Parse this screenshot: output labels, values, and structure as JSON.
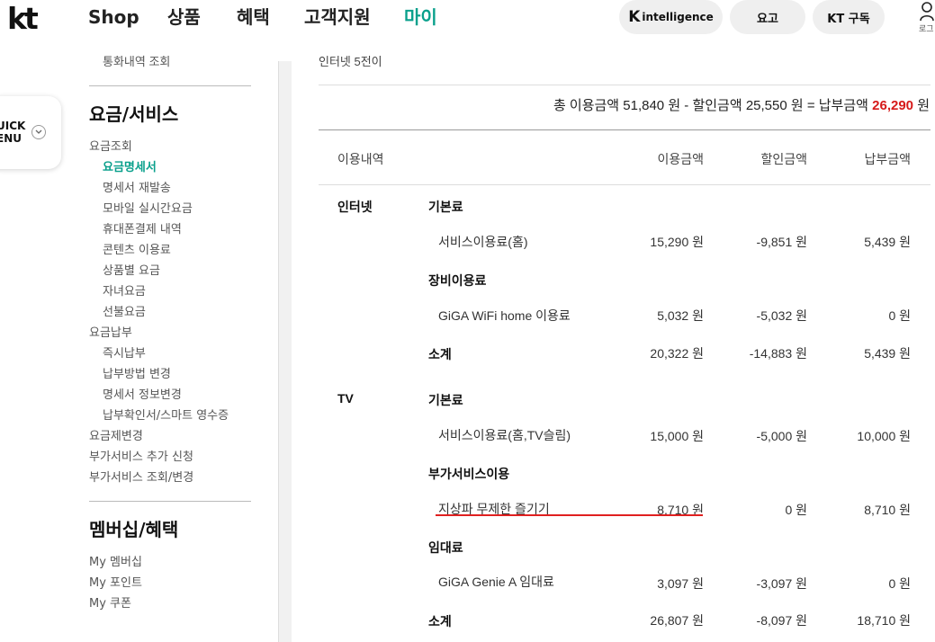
{
  "header": {
    "logo": "kt",
    "nav": [
      "Shop",
      "상품",
      "혜택",
      "고객지원",
      "마이"
    ],
    "active_nav": "마이",
    "pills": {
      "intelligence_k": "K",
      "intelligence_text": "intelligence",
      "fee": "요고",
      "subscribe": "KT 구독"
    },
    "login_label": "로그"
  },
  "quick_menu": {
    "line1": "UICK",
    "line2": "ENU"
  },
  "sidebar": {
    "top_cut_item": "통화내역 조회",
    "section1_title": "요금/서비스",
    "items": [
      {
        "label": "요금조회",
        "level": 1
      },
      {
        "label": "요금명세서",
        "level": 2,
        "active": true
      },
      {
        "label": "명세서 재발송",
        "level": 2
      },
      {
        "label": "모바일 실시간요금",
        "level": 2
      },
      {
        "label": "휴대폰결제 내역",
        "level": 2
      },
      {
        "label": "콘텐츠 이용료",
        "level": 2
      },
      {
        "label": "상품별 요금",
        "level": 2
      },
      {
        "label": "자녀요금",
        "level": 2
      },
      {
        "label": "선불요금",
        "level": 2
      },
      {
        "label": "요금납부",
        "level": 1
      },
      {
        "label": "즉시납부",
        "level": 2
      },
      {
        "label": "납부방법 변경",
        "level": 2
      },
      {
        "label": "명세서 정보변경",
        "level": 2
      },
      {
        "label": "납부확인서/스마트 영수증",
        "level": 2
      },
      {
        "label": "요금제변경",
        "level": 1
      },
      {
        "label": "부가서비스 추가 신청",
        "level": 1
      },
      {
        "label": "부가서비스 조회/변경",
        "level": 1
      }
    ],
    "section2_title": "멤버십/혜택",
    "section2_items": [
      "My 멤버십",
      "My 포인트",
      "My 쿠폰"
    ]
  },
  "main": {
    "top_cut_text": "인터넷 5전이",
    "summary": {
      "prefix": "총 이용금액 51,840 원 - 할인금액 25,550 원 = 납부금액 ",
      "pay_amount": "26,290",
      "suffix": " 원"
    },
    "table_headers": [
      "이용내역",
      "이용금액",
      "할인금액",
      "납부금액"
    ],
    "rows": {
      "internet": {
        "category": "인터넷",
        "g1": "기본료",
        "i1": {
          "name": "서비스이용료(홈)",
          "use": "15,290 원",
          "disc": "-9,851 원",
          "pay": "5,439 원"
        },
        "g2": "장비이용료",
        "i2": {
          "name": "GiGA WiFi home 이용료",
          "use": "5,032 원",
          "disc": "-5,032 원",
          "pay": "0 원"
        },
        "sub": {
          "name": "소계",
          "use": "20,322 원",
          "disc": "-14,883 원",
          "pay": "5,439 원"
        }
      },
      "tv": {
        "category": "TV",
        "g1": "기본료",
        "i1": {
          "name": "서비스이용료(홈,TV슬림)",
          "use": "15,000 원",
          "disc": "-5,000 원",
          "pay": "10,000 원"
        },
        "g2": "부가서비스이용",
        "i2": {
          "name": "지상파 무제한 즐기기",
          "use": "8,710 원",
          "disc": "0 원",
          "pay": "8,710 원"
        },
        "g3": "임대료",
        "i3": {
          "name": "GiGA Genie A 임대료",
          "use": "3,097 원",
          "disc": "-3,097 원",
          "pay": "0 원"
        },
        "sub": {
          "name": "소계",
          "use": "26,807 원",
          "disc": "-8,097 원",
          "pay": "18,710 원"
        }
      }
    }
  },
  "colors": {
    "accent": "#0aa08c",
    "highlight_red": "#d61a1a",
    "underline_red": "#e02020"
  }
}
